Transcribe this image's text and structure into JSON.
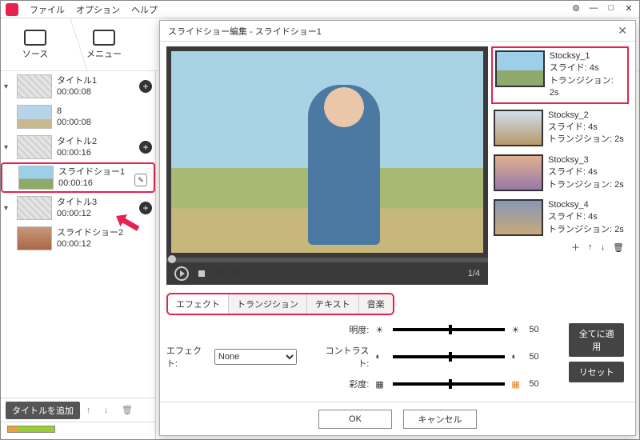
{
  "menu": {
    "file": "ファイル",
    "option": "オプション",
    "help": "ヘルプ"
  },
  "nav": {
    "source": "ソース",
    "menu": "メニュー"
  },
  "tree": [
    {
      "kind": "title",
      "label": "タイトル1",
      "time": "00:00:08",
      "thumb": "ph",
      "add": true,
      "exp": true
    },
    {
      "kind": "clip",
      "label": "8",
      "time": "00:00:08",
      "thumb": "img1"
    },
    {
      "kind": "title",
      "label": "タイトル2",
      "time": "00:00:16",
      "thumb": "ph",
      "add": true,
      "exp": true
    },
    {
      "kind": "clip",
      "label": "スライドショー1",
      "time": "00:00:16",
      "thumb": "img2",
      "sel": true,
      "edit": true
    },
    {
      "kind": "title",
      "label": "タイトル3",
      "time": "00:00:12",
      "thumb": "ph",
      "add": true,
      "exp": true
    },
    {
      "kind": "clip",
      "label": "スライドショー2",
      "time": "00:00:12",
      "thumb": "img3"
    }
  ],
  "sidefoot": {
    "add_title": "タイトルを追加"
  },
  "dialog": {
    "title": "スライドショー編集  -  スライドショー1",
    "counter": "1/4",
    "thumbs": [
      {
        "name": "Stocksy_1",
        "slide": "スライド: 4s",
        "trans": "トランジション: 2s",
        "cls": "p1",
        "sel": true
      },
      {
        "name": "Stocksy_2",
        "slide": "スライド: 4s",
        "trans": "トランジション: 2s",
        "cls": "p2"
      },
      {
        "name": "Stocksy_3",
        "slide": "スライド: 4s",
        "trans": "トランジション: 2s",
        "cls": "p3"
      },
      {
        "name": "Stocksy_4",
        "slide": "スライド: 4s",
        "trans": "トランジション: 2s",
        "cls": "p4"
      }
    ],
    "tabs": {
      "effect": "エフェクト",
      "transition": "トランジション",
      "text": "テキスト",
      "music": "音楽"
    },
    "effect_label": "エフェクト:",
    "effect_value": "None",
    "sliders": {
      "brightness": {
        "label": "明度:",
        "val": "50"
      },
      "contrast": {
        "label": "コントラスト:",
        "val": "50"
      },
      "saturation": {
        "label": "彩度:",
        "val": "50"
      }
    },
    "apply_all": "全てに適用",
    "reset": "リセット",
    "ok": "OK",
    "cancel": "キャンセル"
  }
}
